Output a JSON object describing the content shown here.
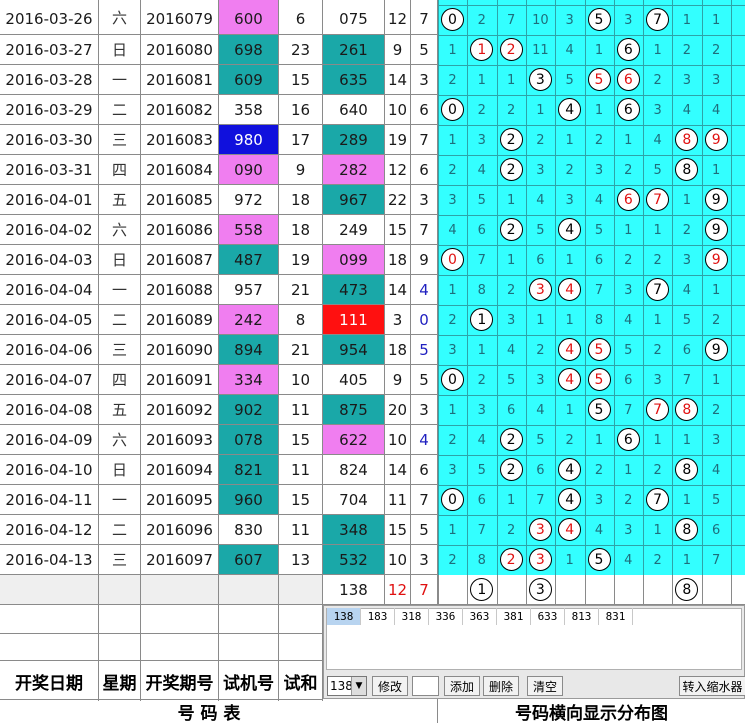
{
  "colors": {
    "teal": "#1aa8a8",
    "pink": "#f07ef0",
    "blue": "#1010dd",
    "red": "#ff1010",
    "cyan": "#33ffff",
    "grid": "#2ea3a8"
  },
  "rows": [
    {
      "date": "2016-03-26",
      "week": "六",
      "issue": "2016079",
      "test": "600",
      "tbg": "pink",
      "sum": "6",
      "draw": "075",
      "dbg": "white",
      "s": "12",
      "k": "7",
      "kc": "black",
      "d": [
        "0",
        "2",
        "7",
        "10",
        "3",
        "5",
        "3",
        "7",
        "1",
        "1"
      ],
      "b": [
        0,
        5,
        7
      ]
    },
    {
      "date": "2016-03-27",
      "week": "日",
      "issue": "2016080",
      "test": "698",
      "tbg": "teal",
      "sum": "23",
      "draw": "261",
      "dbg": "teal",
      "s": "9",
      "k": "5",
      "kc": "black",
      "d": [
        "1",
        "1",
        "2",
        "11",
        "4",
        "1",
        "6",
        "1",
        "2",
        "2"
      ],
      "b": [
        1,
        2,
        6
      ],
      "r": [
        1,
        2
      ]
    },
    {
      "date": "2016-03-28",
      "week": "一",
      "issue": "2016081",
      "test": "609",
      "tbg": "teal",
      "sum": "15",
      "draw": "635",
      "dbg": "teal",
      "s": "14",
      "k": "3",
      "kc": "black",
      "d": [
        "2",
        "1",
        "1",
        "3",
        "5",
        "5",
        "6",
        "2",
        "3",
        "3"
      ],
      "b": [
        3,
        5,
        6
      ],
      "r": [
        5,
        6
      ]
    },
    {
      "date": "2016-03-29",
      "week": "二",
      "issue": "2016082",
      "test": "358",
      "tbg": "white",
      "sum": "16",
      "draw": "640",
      "dbg": "white",
      "s": "10",
      "k": "6",
      "kc": "black",
      "d": [
        "0",
        "2",
        "2",
        "1",
        "4",
        "1",
        "6",
        "3",
        "4",
        "4"
      ],
      "b": [
        0,
        4,
        6
      ]
    },
    {
      "date": "2016-03-30",
      "week": "三",
      "issue": "2016083",
      "test": "980",
      "tbg": "blue",
      "sum": "17",
      "draw": "289",
      "dbg": "teal",
      "s": "19",
      "k": "7",
      "kc": "black",
      "d": [
        "1",
        "3",
        "2",
        "2",
        "1",
        "2",
        "1",
        "4",
        "8",
        "9"
      ],
      "b": [
        2,
        8,
        9
      ],
      "r": [
        8,
        9
      ]
    },
    {
      "date": "2016-03-31",
      "week": "四",
      "issue": "2016084",
      "test": "090",
      "tbg": "pink",
      "sum": "9",
      "draw": "282",
      "dbg": "pink",
      "s": "12",
      "k": "6",
      "kc": "black",
      "d": [
        "2",
        "4",
        "2",
        "3",
        "2",
        "3",
        "2",
        "5",
        "8",
        "1"
      ],
      "b": [
        2,
        8
      ]
    },
    {
      "date": "2016-04-01",
      "week": "五",
      "issue": "2016085",
      "test": "972",
      "tbg": "white",
      "sum": "18",
      "draw": "967",
      "dbg": "teal",
      "s": "22",
      "k": "3",
      "kc": "black",
      "d": [
        "3",
        "5",
        "1",
        "4",
        "3",
        "4",
        "6",
        "7",
        "1",
        "9"
      ],
      "b": [
        6,
        7,
        9
      ],
      "r": [
        6,
        7
      ]
    },
    {
      "date": "2016-04-02",
      "week": "六",
      "issue": "2016086",
      "test": "558",
      "tbg": "pink",
      "sum": "18",
      "draw": "249",
      "dbg": "white",
      "s": "15",
      "k": "7",
      "kc": "black",
      "d": [
        "4",
        "6",
        "2",
        "5",
        "4",
        "5",
        "1",
        "1",
        "2",
        "9"
      ],
      "b": [
        2,
        4,
        9
      ]
    },
    {
      "date": "2016-04-03",
      "week": "日",
      "issue": "2016087",
      "test": "487",
      "tbg": "teal",
      "sum": "19",
      "draw": "099",
      "dbg": "pink",
      "s": "18",
      "k": "9",
      "kc": "black",
      "d": [
        "0",
        "7",
        "1",
        "6",
        "1",
        "6",
        "2",
        "2",
        "3",
        "9"
      ],
      "b": [
        0,
        9
      ],
      "r": [
        0,
        9
      ]
    },
    {
      "date": "2016-04-04",
      "week": "一",
      "issue": "2016088",
      "test": "957",
      "tbg": "white",
      "sum": "21",
      "draw": "473",
      "dbg": "teal",
      "s": "14",
      "k": "4",
      "kc": "blue",
      "d": [
        "1",
        "8",
        "2",
        "3",
        "4",
        "7",
        "3",
        "7",
        "4",
        "1"
      ],
      "b": [
        3,
        4,
        7
      ],
      "r": [
        3,
        4
      ]
    },
    {
      "date": "2016-04-05",
      "week": "二",
      "issue": "2016089",
      "test": "242",
      "tbg": "pink",
      "sum": "8",
      "draw": "111",
      "dbg": "red",
      "s": "3",
      "k": "0",
      "kc": "blue",
      "d": [
        "2",
        "1",
        "3",
        "1",
        "1",
        "8",
        "4",
        "1",
        "5",
        "2"
      ],
      "b": [
        1
      ]
    },
    {
      "date": "2016-04-06",
      "week": "三",
      "issue": "2016090",
      "test": "894",
      "tbg": "teal",
      "sum": "21",
      "draw": "954",
      "dbg": "teal",
      "s": "18",
      "k": "5",
      "kc": "blue",
      "d": [
        "3",
        "1",
        "4",
        "2",
        "4",
        "5",
        "5",
        "2",
        "6",
        "9"
      ],
      "b": [
        4,
        5,
        9
      ],
      "r": [
        4,
        5
      ]
    },
    {
      "date": "2016-04-07",
      "week": "四",
      "issue": "2016091",
      "test": "334",
      "tbg": "pink",
      "sum": "10",
      "draw": "405",
      "dbg": "white",
      "s": "9",
      "k": "5",
      "kc": "black",
      "d": [
        "0",
        "2",
        "5",
        "3",
        "4",
        "5",
        "6",
        "3",
        "7",
        "1"
      ],
      "b": [
        0,
        4,
        5
      ],
      "r": [
        4,
        5
      ]
    },
    {
      "date": "2016-04-08",
      "week": "五",
      "issue": "2016092",
      "test": "902",
      "tbg": "teal",
      "sum": "11",
      "draw": "875",
      "dbg": "teal",
      "s": "20",
      "k": "3",
      "kc": "black",
      "d": [
        "1",
        "3",
        "6",
        "4",
        "1",
        "5",
        "7",
        "7",
        "8",
        "2"
      ],
      "b": [
        5,
        7,
        8
      ],
      "r": [
        7,
        8
      ]
    },
    {
      "date": "2016-04-09",
      "week": "六",
      "issue": "2016093",
      "test": "078",
      "tbg": "teal",
      "sum": "15",
      "draw": "622",
      "dbg": "pink",
      "s": "10",
      "k": "4",
      "kc": "blue",
      "d": [
        "2",
        "4",
        "2",
        "5",
        "2",
        "1",
        "6",
        "1",
        "1",
        "3"
      ],
      "b": [
        2,
        6
      ]
    },
    {
      "date": "2016-04-10",
      "week": "日",
      "issue": "2016094",
      "test": "821",
      "tbg": "teal",
      "sum": "11",
      "draw": "824",
      "dbg": "white",
      "s": "14",
      "k": "6",
      "kc": "black",
      "d": [
        "3",
        "5",
        "2",
        "6",
        "4",
        "2",
        "1",
        "2",
        "8",
        "4"
      ],
      "b": [
        2,
        4,
        8
      ]
    },
    {
      "date": "2016-04-11",
      "week": "一",
      "issue": "2016095",
      "test": "960",
      "tbg": "teal",
      "sum": "15",
      "draw": "704",
      "dbg": "white",
      "s": "11",
      "k": "7",
      "kc": "black",
      "d": [
        "0",
        "6",
        "1",
        "7",
        "4",
        "3",
        "2",
        "7",
        "1",
        "5"
      ],
      "b": [
        0,
        4,
        7
      ]
    },
    {
      "date": "2016-04-12",
      "week": "二",
      "issue": "2016096",
      "test": "830",
      "tbg": "white",
      "sum": "11",
      "draw": "348",
      "dbg": "teal",
      "s": "15",
      "k": "5",
      "kc": "black",
      "d": [
        "1",
        "7",
        "2",
        "3",
        "4",
        "4",
        "3",
        "1",
        "8",
        "6"
      ],
      "b": [
        3,
        4,
        8
      ],
      "r": [
        3,
        4
      ]
    },
    {
      "date": "2016-04-13",
      "week": "三",
      "issue": "2016097",
      "test": "607",
      "tbg": "teal",
      "sum": "13",
      "draw": "532",
      "dbg": "teal",
      "s": "10",
      "k": "3",
      "kc": "black",
      "d": [
        "2",
        "8",
        "2",
        "3",
        "1",
        "5",
        "4",
        "2",
        "1",
        "7"
      ],
      "b": [
        2,
        3,
        5
      ],
      "r": [
        2,
        3
      ]
    }
  ],
  "summary": {
    "draw": "138",
    "s": "12",
    "k": "7",
    "balls": [
      "1",
      "3",
      "8"
    ]
  },
  "panel": {
    "numbers": [
      "138",
      "183",
      "318",
      "336",
      "363",
      "381",
      "633",
      "813",
      "831"
    ],
    "select_value": "138",
    "modify": "修改",
    "add": "添加",
    "delete": "删除",
    "clear": "清空",
    "transfer": "转入缩水器"
  },
  "headers": {
    "date": "开奖日期",
    "week": "星期",
    "issue": "开奖期号",
    "test": "试机号",
    "sum": "试和"
  },
  "captions": {
    "left": "号 码 表",
    "right": "号码横向显示分布图"
  }
}
